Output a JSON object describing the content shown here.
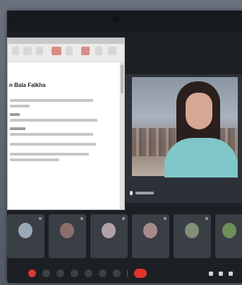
{
  "slides": {
    "title": "n Bala Falkha"
  },
  "speaker": {},
  "participants": [
    {
      "label": "",
      "avatar_color": "#9aa8b6"
    },
    {
      "label": "",
      "avatar_color": "#8b6f6b"
    },
    {
      "label": "",
      "avatar_color": "#b3a1a8"
    },
    {
      "label": "",
      "avatar_color": "#a88a8c"
    },
    {
      "label": "",
      "avatar_color": "#7f8f78"
    },
    {
      "label": "",
      "avatar_color": "#6e8f59"
    }
  ],
  "colors": {
    "background": "#1c1f24",
    "tile": "#3a3e45",
    "end_call": "#e0342b",
    "mic_off": "#d93a32"
  },
  "icons": [
    "microphone-icon",
    "camera-icon",
    "captions-icon",
    "emoji-icon",
    "present-icon",
    "raise-hand-icon",
    "more-icon",
    "end-call-icon",
    "info-icon",
    "people-icon",
    "chat-icon"
  ]
}
